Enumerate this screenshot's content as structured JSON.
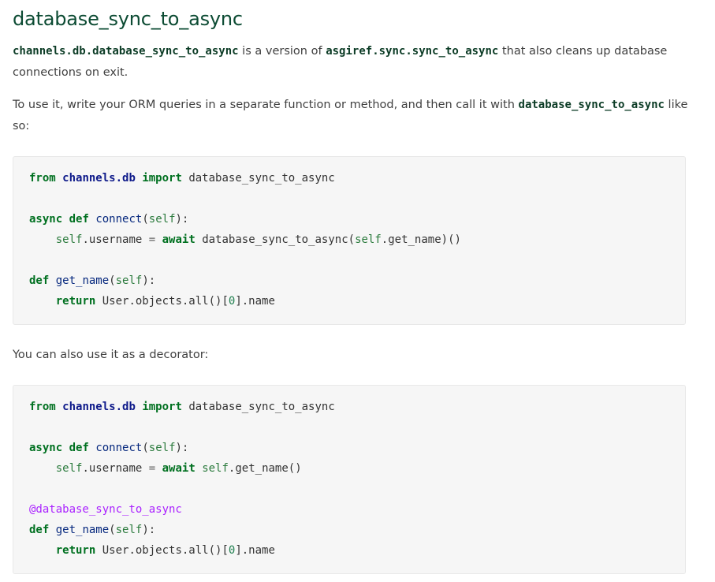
{
  "heading": "database_sync_to_async",
  "para1": {
    "code_a": "channels.db.database_sync_to_async",
    "text_a": " is a version of ",
    "code_b": "asgiref.sync.sync_to_async",
    "text_b": " that also cleans up database connections on exit."
  },
  "para2": {
    "text_a": "To use it, write your ORM queries in a separate function or method, and then call it with ",
    "code_a": "database_sync_to_async",
    "text_b": " like so:"
  },
  "para3": {
    "text": "You can also use it as a decorator:"
  },
  "code1": {
    "l1_from": "from",
    "l1_mod": "channels.db",
    "l1_import": "import",
    "l1_name": " database_sync_to_async",
    "l3_async": "async",
    "l3_def": "def",
    "l3_fn": "connect",
    "l3_open": "(",
    "l3_self": "self",
    "l3_close": "):",
    "l4_indent": "    ",
    "l4_self": "self",
    "l4_attr": ".username ",
    "l4_eq": "=",
    "l4_await": "await",
    "l4_rest_a": " database_sync_to_async(",
    "l4_self2": "self",
    "l4_rest_b": ".get_name)()",
    "l6_def": "def",
    "l6_fn": "get_name",
    "l6_open": "(",
    "l6_self": "self",
    "l6_close": "):",
    "l7_indent": "    ",
    "l7_return": "return",
    "l7_rest_a": " User.objects.all()[",
    "l7_num": "0",
    "l7_rest_b": "].name"
  },
  "code2": {
    "l1_from": "from",
    "l1_mod": "channels.db",
    "l1_import": "import",
    "l1_name": " database_sync_to_async",
    "l3_async": "async",
    "l3_def": "def",
    "l3_fn": "connect",
    "l3_open": "(",
    "l3_self": "self",
    "l3_close": "):",
    "l4_indent": "    ",
    "l4_self": "self",
    "l4_attr": ".username ",
    "l4_eq": "=",
    "l4_await": "await",
    "l4_sp": " ",
    "l4_self2": "self",
    "l4_rest": ".get_name()",
    "l6_decorator": "@database_sync_to_async",
    "l7_def": "def",
    "l7_fn": "get_name",
    "l7_open": "(",
    "l7_self": "self",
    "l7_close": "):",
    "l8_indent": "    ",
    "l8_return": "return",
    "l8_rest_a": " User.objects.all()[",
    "l8_num": "0",
    "l8_rest_b": "].name"
  },
  "colors": {
    "heading": "#0c4b33",
    "inline_code": "#0c3c26",
    "keyword": "#007020",
    "module": "#0e1a8a",
    "function": "#06287e",
    "decorator": "#aa22ff",
    "code_background": "#f6f6f6"
  }
}
